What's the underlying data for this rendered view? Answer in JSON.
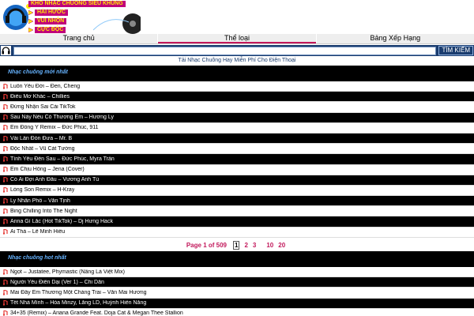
{
  "header": {
    "title": "KHO NHẠC CHUÔNG SIÊU KHỦNG",
    "menu": [
      "HÀI HƯỚC",
      "VUI NHỘN",
      "CỰC ĐỘC"
    ]
  },
  "nav": {
    "tabs": [
      {
        "label": "Trang chủ",
        "active": false
      },
      {
        "label": "Thể loại",
        "active": true
      },
      {
        "label": "Bảng Xếp Hạng",
        "active": false
      }
    ]
  },
  "search": {
    "value": "",
    "button_label": "TÌM KIẾM"
  },
  "subtitle": "Tải Nhạc Chuông Hay Miễn Phí Cho Điện Thoại",
  "section_new": {
    "heading": "Nhạc chuông mới nhất",
    "items": [
      "Luôn Yêu Đời – Đen, Cheng",
      "Điều Mơ Khác – Chillies",
      "Đừng Nhận Sai Cái TikTok",
      "Sau Này Nếu Có Thương Em – Hương Ly",
      "Em Đồng Ý Remix – Đức Phúc, 911",
      "Vài Lần Đón Đưa – Mr. B",
      "Độc Nhất – Vũ Cát Tường",
      "Tình Yêu Đến Sau – Đức Phúc, Myra Trần",
      "Em Chịu Hông – Jena (Cover)",
      "Có Ai Đợi Anh Đâu – Vương Anh Tú",
      "Lòng Son Remix – H-Kray",
      "Ly Nhân Phố – Văn Tịnh",
      "Bing Chilling Into The Night",
      "Anna Gì Lắc (Hot TikTok) – Dj Hưng Hack",
      "Ai Thả – Lê Minh Hiếu"
    ]
  },
  "pager": {
    "label": "Page 1 of 509",
    "pages": [
      "1",
      "2",
      "3",
      "10",
      "20"
    ],
    "current": "1"
  },
  "section_hot": {
    "heading": "Nhạc chuông hot nhất",
    "items": [
      "Ngọt – Justatee, Phymastic (Nâng Là Việt Mix)",
      "Người Yêu Điên Dại (Ver 1) – Chi Dân",
      "Mai Đây Em Thương Một Chàng Trai – Văn Mai Hương",
      "Tết Nhà Mình – Hòa Minzy, Lăng LD, Huỳnh Hiền Năng",
      "34+35 (Remix) – Ariana Grande Feat. Doja Cat & Megan Thee Stallion"
    ]
  },
  "colors": {
    "brand": "#c0007a",
    "accent": "#1a3c6e",
    "pager": "#c2185b",
    "heading_text": "#66b3ff"
  },
  "icons": {
    "headphone": "headphone-icon",
    "ringtone": "ringtone-icon"
  }
}
